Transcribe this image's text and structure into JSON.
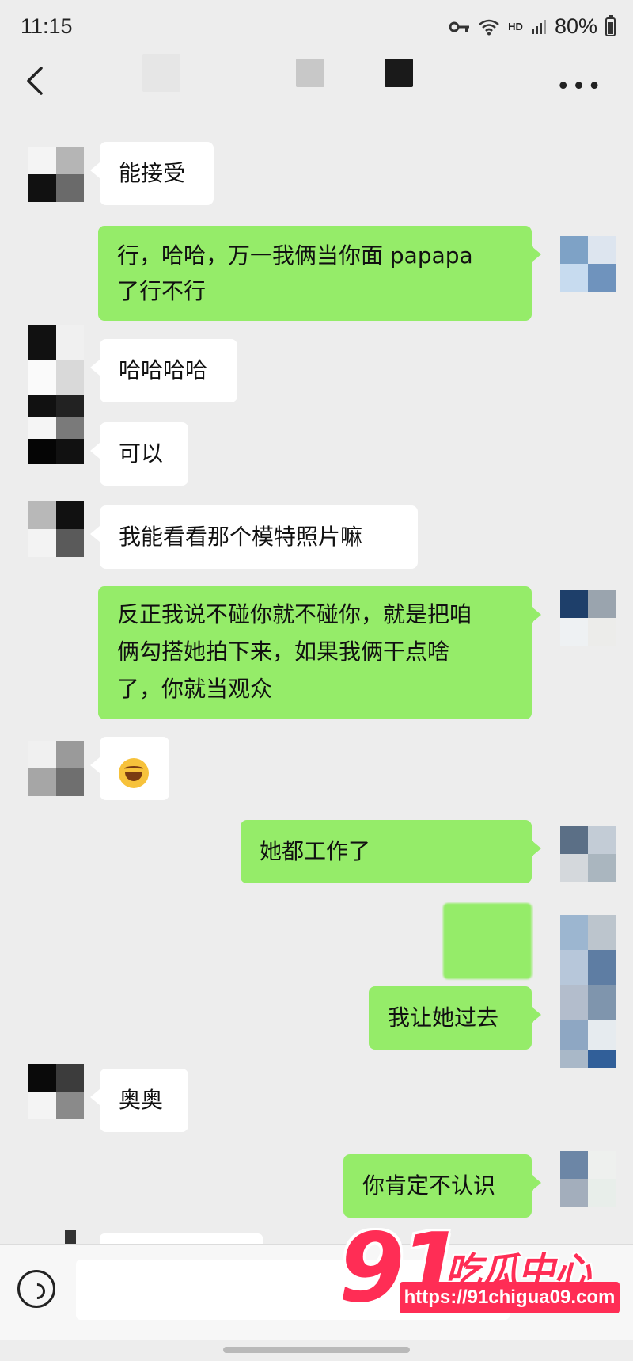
{
  "status_bar": {
    "time": "11:15",
    "network": "HD",
    "battery": "80%"
  },
  "nav": {
    "back_icon": "chevron-left-icon",
    "more_icon": "more-dots-icon",
    "more_text": "•••"
  },
  "messages": [
    {
      "side": "in",
      "text": "能接受"
    },
    {
      "side": "out",
      "text": "行，哈哈，万一我俩当你面 papapa\n了行不行"
    },
    {
      "side": "in",
      "text": "哈哈哈哈"
    },
    {
      "side": "in",
      "text": "可以"
    },
    {
      "side": "in",
      "text": "我能看看那个模特照片嘛"
    },
    {
      "side": "out",
      "text": "反正我说不碰你就不碰你，就是把咱\n俩勾搭她拍下来，如果我俩干点啥\n了，你就当观众"
    },
    {
      "side": "in",
      "text": "",
      "emoji": "laughing-tears-emoji"
    },
    {
      "side": "out",
      "text": "她都工作了"
    },
    {
      "side": "out",
      "text": "",
      "blurred": true
    },
    {
      "side": "out",
      "text": "我让她过去"
    },
    {
      "side": "in",
      "text": "奥奥"
    },
    {
      "side": "out",
      "text": "你肯定不认识"
    }
  ],
  "input_bar": {
    "voice_icon": "voice-icon",
    "input_value": ""
  },
  "watermark": {
    "logo_number": "91",
    "brand": "吃瓜中心",
    "url": "https://91chigua09.com"
  },
  "colors": {
    "background": "#ededed",
    "outgoing_bubble": "#95ec69",
    "incoming_bubble": "#ffffff",
    "watermark": "#ff2d55"
  }
}
